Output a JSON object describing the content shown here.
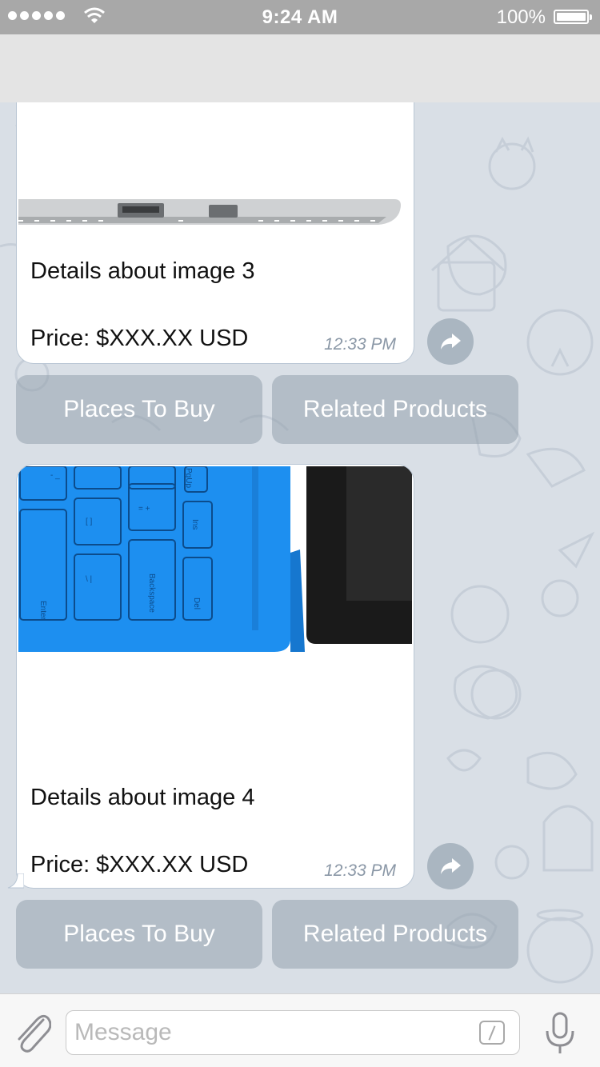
{
  "status_bar": {
    "time": "9:24 AM",
    "battery": "100%",
    "signal_icon": "signal-dots-icon",
    "wifi_icon": "wifi-icon",
    "battery_icon": "battery-icon"
  },
  "messages": [
    {
      "image": "laptop-ports-image",
      "details": "Details about image 3",
      "price": "Price: $XXX.XX USD",
      "time": "12:33 PM",
      "buttons": {
        "places": "Places To Buy",
        "related": "Related Products"
      }
    },
    {
      "image": "blue-keyboard-cover-image",
      "details": "Details about image 4",
      "price": "Price: $XXX.XX USD",
      "time": "12:33 PM",
      "buttons": {
        "places": "Places To Buy",
        "related": "Related Products"
      }
    }
  ],
  "composer": {
    "placeholder": "Message",
    "attach_icon": "paperclip-icon",
    "command_icon": "slash-command-icon",
    "mic_icon": "microphone-icon"
  },
  "colors": {
    "status_bar": "#a8a8a8",
    "chat_background": "#d9dfe6",
    "keyboard_button": "#9aa7b4",
    "keyboard_blue": "#1d8ff0"
  }
}
